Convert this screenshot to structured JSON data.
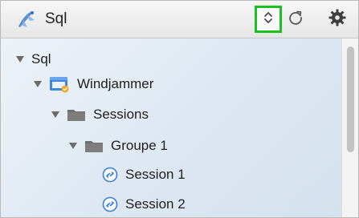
{
  "toolbar": {
    "title": "Sql",
    "app_icon": "sql-app-icon",
    "buttons": [
      {
        "name": "sort-toggle-button",
        "icon": "up-down-chevron-icon",
        "highlight": "#19c21f"
      },
      {
        "name": "refresh-button",
        "icon": "refresh-icon"
      },
      {
        "name": "settings-button",
        "icon": "gear-icon"
      }
    ]
  },
  "tree": {
    "root": {
      "label": "Sql",
      "expanded": true
    },
    "connection": {
      "label": "Windjammer",
      "icon": "database-connection-icon",
      "expanded": true
    },
    "sessions_folder": {
      "label": "Sessions",
      "icon": "folder-icon",
      "expanded": true
    },
    "group": {
      "label": "Groupe 1",
      "icon": "folder-icon",
      "expanded": true
    },
    "items": [
      {
        "label": "Session 1",
        "icon": "session-icon"
      },
      {
        "label": "Session 2",
        "icon": "session-icon"
      }
    ]
  },
  "colors": {
    "highlight": "#19c21f",
    "session_icon": "#3a7fe0",
    "folder": "#6f6f6f"
  }
}
